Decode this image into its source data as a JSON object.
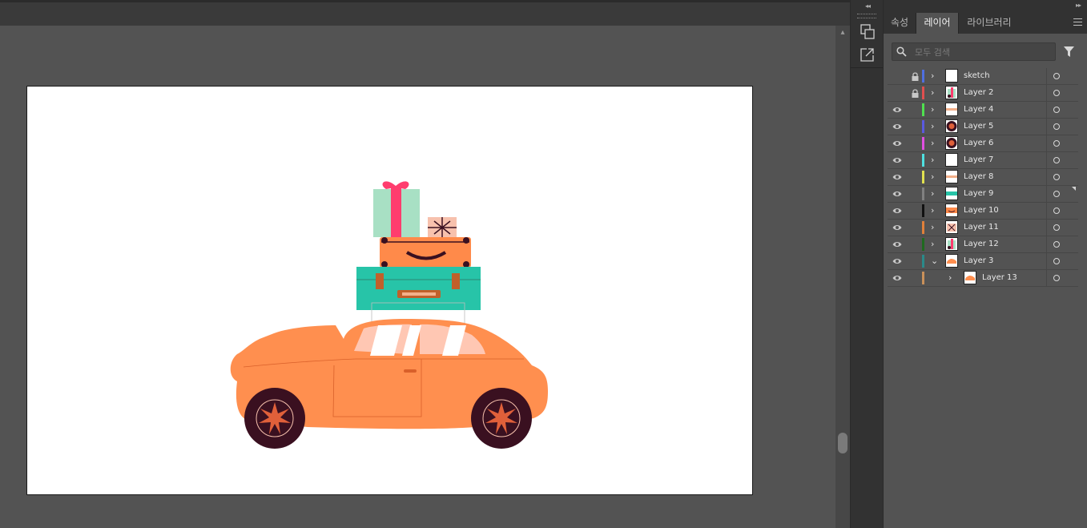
{
  "panel": {
    "tabs": [
      {
        "label": "속성",
        "active": false
      },
      {
        "label": "레이어",
        "active": true
      },
      {
        "label": "라이브러리",
        "active": false
      }
    ],
    "search_placeholder": "모두 검색"
  },
  "layers": [
    {
      "name": "sketch",
      "visible": false,
      "locked": true,
      "color": "#4f6fe0",
      "expanded": false,
      "indent": 0,
      "thumb": "blank"
    },
    {
      "name": "Layer 2",
      "visible": false,
      "locked": true,
      "color": "#e04f4f",
      "expanded": false,
      "indent": 0,
      "thumb": "gift"
    },
    {
      "name": "Layer 4",
      "visible": true,
      "locked": false,
      "color": "#4fe04f",
      "expanded": false,
      "indent": 0,
      "thumb": "stripe"
    },
    {
      "name": "Layer 5",
      "visible": true,
      "locked": false,
      "color": "#5a5ae0",
      "expanded": false,
      "indent": 0,
      "thumb": "wheel"
    },
    {
      "name": "Layer 6",
      "visible": true,
      "locked": false,
      "color": "#e04fe0",
      "expanded": false,
      "indent": 0,
      "thumb": "wheel"
    },
    {
      "name": "Layer 7",
      "visible": true,
      "locked": false,
      "color": "#4fe0e0",
      "expanded": false,
      "indent": 0,
      "thumb": "blank"
    },
    {
      "name": "Layer 8",
      "visible": true,
      "locked": false,
      "color": "#e0e04f",
      "expanded": false,
      "indent": 0,
      "thumb": "stripe"
    },
    {
      "name": "Layer 9",
      "visible": true,
      "locked": false,
      "color": "#808080",
      "expanded": false,
      "indent": 0,
      "thumb": "teal"
    },
    {
      "name": "Layer 10",
      "visible": true,
      "locked": false,
      "color": "#111111",
      "expanded": false,
      "indent": 0,
      "thumb": "suitcase"
    },
    {
      "name": "Layer 11",
      "visible": true,
      "locked": false,
      "color": "#e0803a",
      "expanded": false,
      "indent": 0,
      "thumb": "bow"
    },
    {
      "name": "Layer 12",
      "visible": true,
      "locked": false,
      "color": "#1f6a1f",
      "expanded": false,
      "indent": 0,
      "thumb": "gift"
    },
    {
      "name": "Layer 3",
      "visible": true,
      "locked": false,
      "color": "#2a8a8a",
      "expanded": true,
      "indent": 0,
      "thumb": "car"
    },
    {
      "name": "Layer 13",
      "visible": true,
      "locked": false,
      "color": "#c9905a",
      "expanded": false,
      "indent": 1,
      "thumb": "car"
    }
  ],
  "icons": {
    "panel_collapse": "double-chevron-left-icon",
    "panel_expand": "double-chevron-right-icon",
    "arrange": "arrange-documents-icon",
    "export": "export-icon",
    "search": "search-icon",
    "filter": "filter-icon",
    "menu": "hamburger-menu-icon"
  },
  "colors": {
    "car": "#ff8f4f",
    "suitcase_teal": "#27c4a8",
    "suitcase_orange": "#ff8a4a",
    "gift_mint": "#a8e0c4",
    "gift_pink": "#ff3d6e",
    "tire": "#3a1020"
  }
}
